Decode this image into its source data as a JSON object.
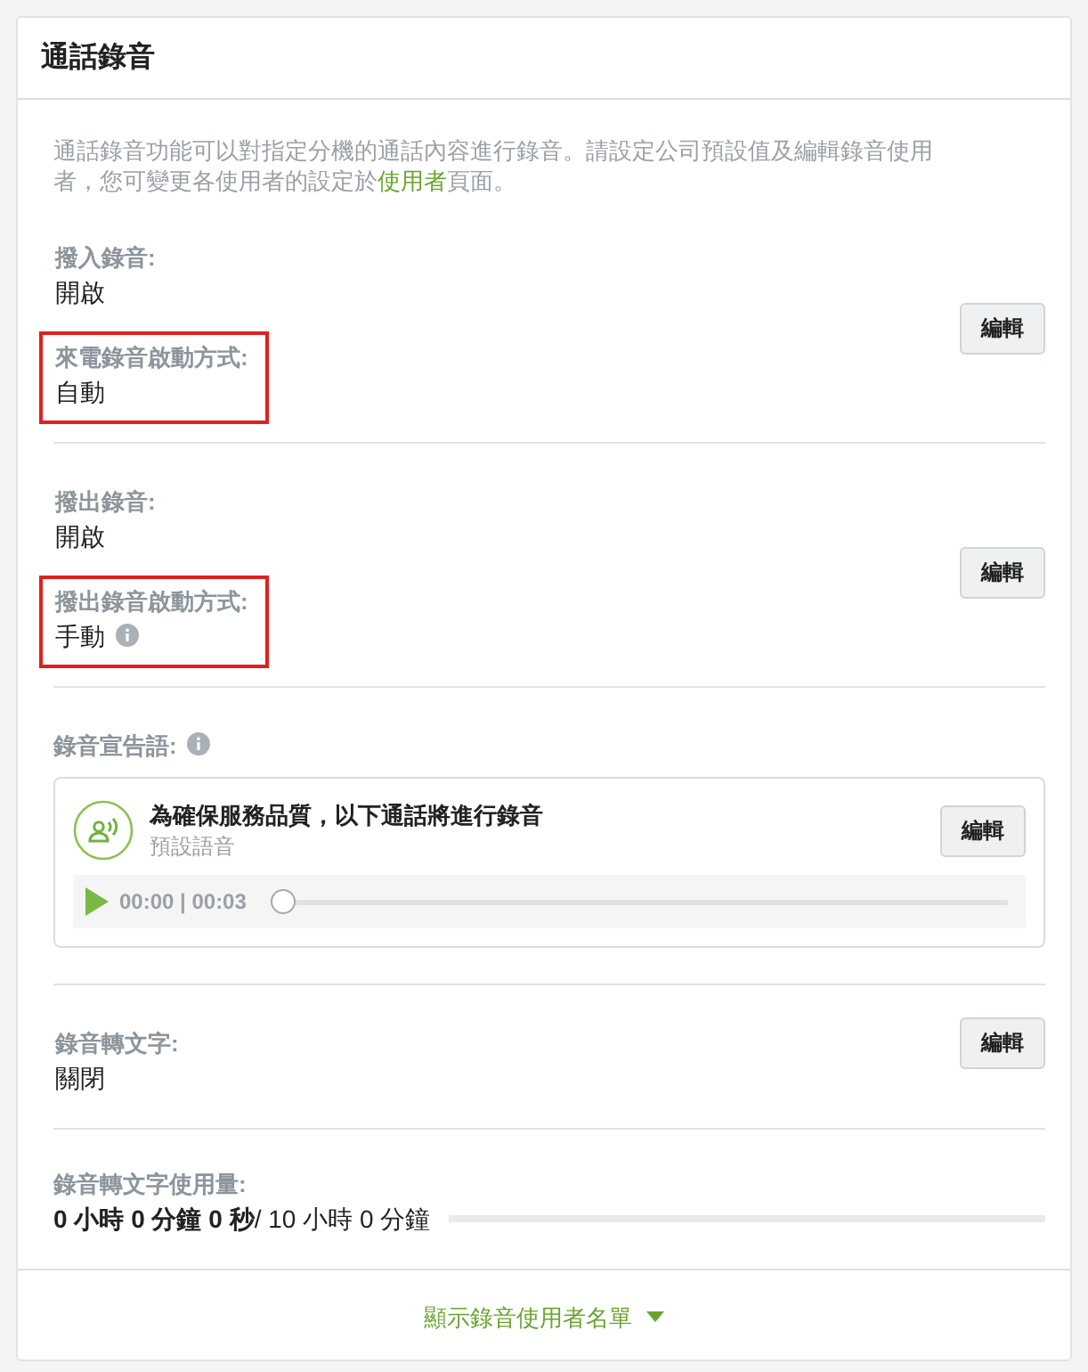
{
  "title": "通話錄音",
  "intro": "通話錄音功能可以對指定分機的通話內容進行錄音。請設定公司預設值及編輯錄音使用者，您可變更各使用者的設定於",
  "intro_link": "使用者",
  "intro_end": "頁面。",
  "sections": [
    {
      "kind": "settings",
      "button": "編輯",
      "fields": [
        {
          "label": "撥入錄音:",
          "value": "開啟",
          "highlighted": false,
          "info": false
        },
        {
          "label": "來電錄音啟動方式:",
          "value": "自動",
          "highlighted": true,
          "info": false
        }
      ]
    },
    {
      "kind": "settings",
      "button": "編輯",
      "fields": [
        {
          "label": "撥出錄音:",
          "value": "開啟",
          "highlighted": false,
          "info": false
        },
        {
          "label": "撥出錄音啟動方式:",
          "value": "手動",
          "highlighted": true,
          "info": true
        }
      ]
    },
    {
      "kind": "announcement",
      "label": "錄音宣告語:",
      "info": true,
      "message": "為確保服務品質，以下通話將進行錄音",
      "subtitle": "預設語音",
      "button": "編輯",
      "time": "00:00 | 00:03",
      "level": 0
    },
    {
      "kind": "settings",
      "button": "編輯",
      "fields": [
        {
          "label": "錄音轉文字:",
          "value": "關閉",
          "highlighted": false,
          "info": false
        }
      ]
    },
    {
      "kind": "usage",
      "label": "錄音轉文字使用量:",
      "text": "**0 小時 0 分鐘 0 秒**/ 10 小時 0 分鐘",
      "level": 0
    }
  ],
  "footer_link": "顯示錄音使用者名單"
}
